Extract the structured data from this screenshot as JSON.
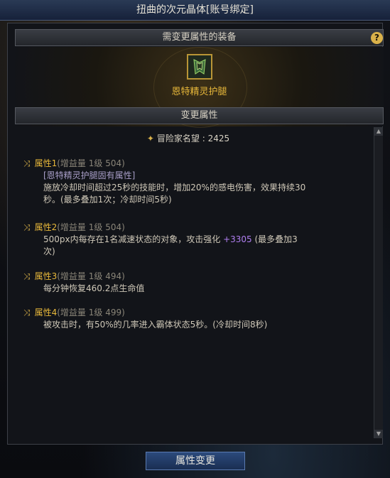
{
  "window": {
    "title": "扭曲的次元晶体[账号绑定]"
  },
  "equip_section": {
    "title": "需变更属性的装备",
    "help_label": "?",
    "item_name": "恩特精灵护腿"
  },
  "attr_section": {
    "title": "变更属性"
  },
  "reputation": {
    "label": "冒险家名望",
    "value": ": 2425"
  },
  "attributes": [
    {
      "title": "属性1",
      "sub": "(增益量 1级 504)",
      "lines": [
        "[恩特精灵护腿固有属性]",
        "施放冷却时间超过25秒的技能时，增加20%的感电伤害，效果持续30",
        "秒。(最多叠加1次；冷却时间5秒)"
      ]
    },
    {
      "title": "属性2",
      "sub": "(增益量 1级 504)",
      "line1_pre": "500px内每存在1名减速状态的对象，攻击强化 ",
      "line1_highlight": "+3305",
      "line1_post": " (最多叠加3",
      "line2": "次)"
    },
    {
      "title": "属性3",
      "sub": "(增益量 1级 494)",
      "lines": [
        "每分钟恢复460.2点生命值"
      ]
    },
    {
      "title": "属性4",
      "sub": "(增益量 1级 499)",
      "lines": [
        "被攻击时，有50%的几率进入霸体状态5秒。(冷却时间8秒)"
      ]
    }
  ],
  "footer": {
    "confirm_label": "属性变更"
  },
  "colors": {
    "accent_gold": "#e8b83a",
    "highlight_purple": "#b07ef0",
    "button_blue": "#2b4a7c"
  }
}
